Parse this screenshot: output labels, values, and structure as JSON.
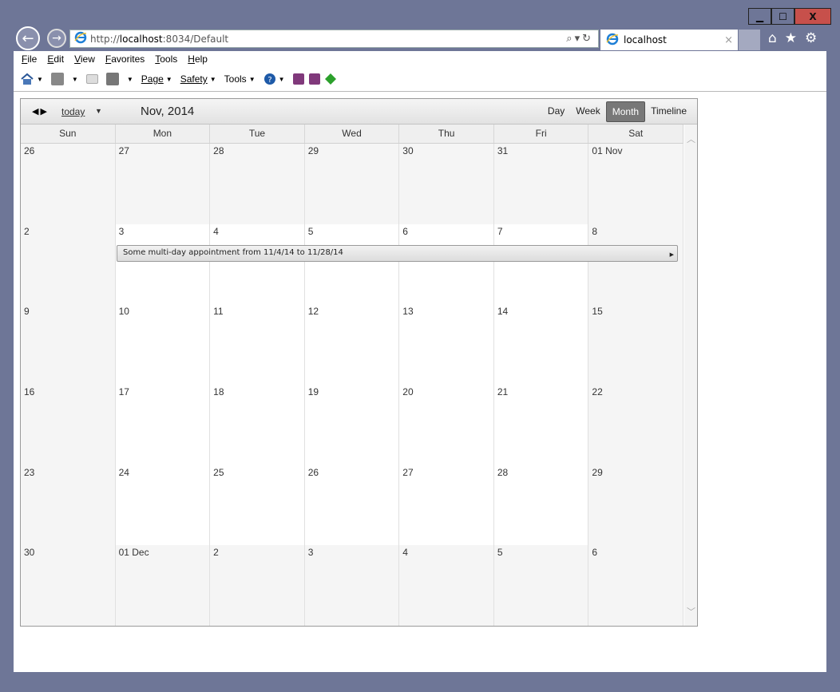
{
  "window": {
    "minimize": "▁",
    "maximize": "☐",
    "close": "X"
  },
  "nav": {
    "back_icon": "←",
    "forward_icon": "→"
  },
  "address": {
    "url_prefix": "http://",
    "url_host": "localhost",
    "url_rest": ":8034/Default"
  },
  "tab": {
    "title": "localhost",
    "close": "×"
  },
  "toolbar_icons": {
    "home": "⌂",
    "favorites": "★",
    "settings": "⚙"
  },
  "menu": [
    "File",
    "Edit",
    "View",
    "Favorites",
    "Tools",
    "Help"
  ],
  "commandbar": {
    "page": "Page",
    "safety": "Safety",
    "tools": "Tools"
  },
  "scheduler": {
    "today_label": "today",
    "title": "Nov, 2014",
    "views": [
      "Day",
      "Week",
      "Month",
      "Timeline"
    ],
    "active_view": "Month",
    "day_headers": [
      "Sun",
      "Mon",
      "Tue",
      "Wed",
      "Thu",
      "Fri",
      "Sat"
    ],
    "weeks": [
      [
        "26",
        "27",
        "28",
        "29",
        "30",
        "31",
        "01 Nov"
      ],
      [
        "2",
        "3",
        "4",
        "5",
        "6",
        "7",
        "8"
      ],
      [
        "9",
        "10",
        "11",
        "12",
        "13",
        "14",
        "15"
      ],
      [
        "16",
        "17",
        "18",
        "19",
        "20",
        "21",
        "22"
      ],
      [
        "23",
        "24",
        "25",
        "26",
        "27",
        "28",
        "29"
      ],
      [
        "30",
        "01 Dec",
        "2",
        "3",
        "4",
        "5",
        "6"
      ]
    ],
    "appointment": "Some multi-day appointment from 11/4/14 to 11/28/14"
  }
}
